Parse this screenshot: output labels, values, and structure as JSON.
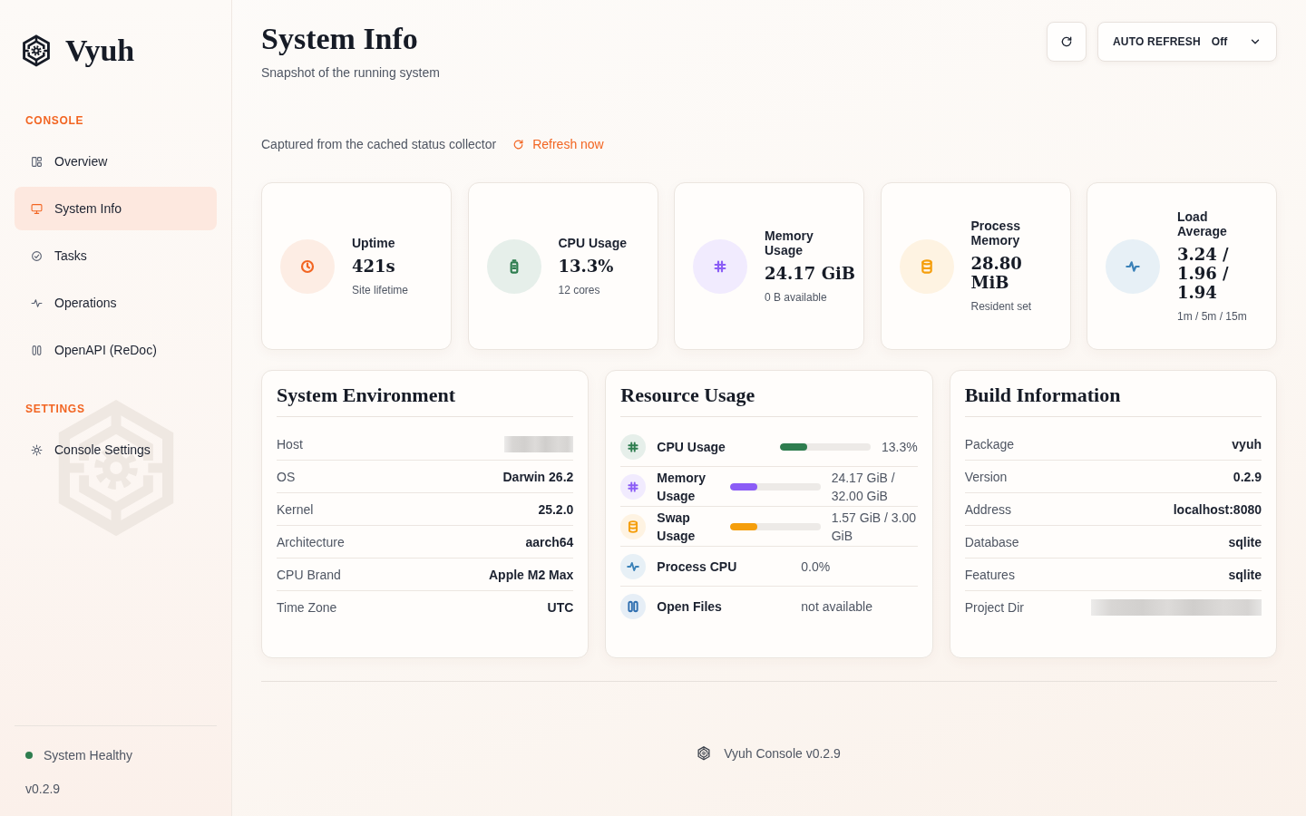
{
  "sidebar": {
    "brand": "Vyuh",
    "sections": [
      {
        "title": "CONSOLE",
        "items": [
          {
            "label": "Overview",
            "selected": false
          },
          {
            "label": "System Info",
            "selected": true
          },
          {
            "label": "Tasks",
            "selected": false
          },
          {
            "label": "Operations",
            "selected": false
          },
          {
            "label": "OpenAPI (ReDoc)",
            "selected": false
          }
        ]
      },
      {
        "title": "SETTINGS",
        "items": [
          {
            "label": "Console Settings",
            "selected": false
          }
        ]
      }
    ],
    "status": {
      "label": "System Healthy",
      "healthy": true
    },
    "version": "v0.2.9"
  },
  "header": {
    "title": "System Info",
    "subtitle": "Snapshot of the running system",
    "auto_refresh": {
      "label": "AUTO REFRESH",
      "value": "Off"
    }
  },
  "notice": {
    "text": "Captured from the cached status collector",
    "action": "Refresh now"
  },
  "stats": [
    {
      "label": "Uptime",
      "value": "421s",
      "caption": "Site lifetime",
      "color": "#f26522"
    },
    {
      "label": "CPU Usage",
      "value": "13.3%",
      "caption": "12 cores",
      "color": "#2e7d4f"
    },
    {
      "label": "Memory Usage",
      "value": "24.17 GiB",
      "caption": "0 B available",
      "color": "#8b5cf6"
    },
    {
      "label": "Process Memory",
      "value": "28.80 MiB",
      "caption": "Resident set",
      "color": "#f59e0b"
    },
    {
      "label": "Load Average",
      "value": "3.24 / 1.96 / 1.94",
      "caption": "1m / 5m / 15m",
      "color": "#3b82b8"
    }
  ],
  "environment": {
    "title": "System Environment",
    "rows": [
      {
        "label": "Host",
        "redacted": true
      },
      {
        "label": "OS",
        "value": "Darwin 26.2",
        "redacted": false
      },
      {
        "label": "Kernel",
        "value": "25.2.0",
        "redacted": false
      },
      {
        "label": "Architecture",
        "value": "aarch64",
        "redacted": false
      },
      {
        "label": "CPU Brand",
        "value": "Apple M2 Max",
        "redacted": false
      },
      {
        "label": "Time Zone",
        "value": "UTC",
        "redacted": false
      }
    ]
  },
  "resources": {
    "title": "Resource Usage",
    "rows": [
      {
        "kind": "bar",
        "label": "CPU Usage",
        "level": 0.3,
        "value": "13.3%",
        "color": "#2e7d4f"
      },
      {
        "kind": "bar",
        "label": "Memory Usage",
        "level": 0.3,
        "value": "24.17 GiB / 32.00 GiB",
        "color": "#8b5cf6"
      },
      {
        "kind": "bar",
        "label": "Swap Usage",
        "level": 0.3,
        "value": "1.57 GiB / 3.00 GiB",
        "color": "#f59e0b"
      },
      {
        "kind": "text",
        "label": "Process CPU",
        "value": "0.0%",
        "color": "#3b82b8"
      },
      {
        "kind": "text",
        "label": "Open Files",
        "value": "not available",
        "color": "#2f6fb0"
      }
    ]
  },
  "build": {
    "title": "Build Information",
    "rows": [
      {
        "label": "Package",
        "value": "vyuh",
        "redacted": false
      },
      {
        "label": "Version",
        "value": "0.2.9",
        "redacted": false
      },
      {
        "label": "Address",
        "value": "localhost:8080",
        "redacted": false
      },
      {
        "label": "Database",
        "value": "sqlite",
        "redacted": false
      },
      {
        "label": "Features",
        "value": "sqlite",
        "redacted": false
      },
      {
        "label": "Project Dir",
        "redacted": true
      }
    ]
  },
  "footer": {
    "text": "Vyuh Console v0.2.9"
  }
}
